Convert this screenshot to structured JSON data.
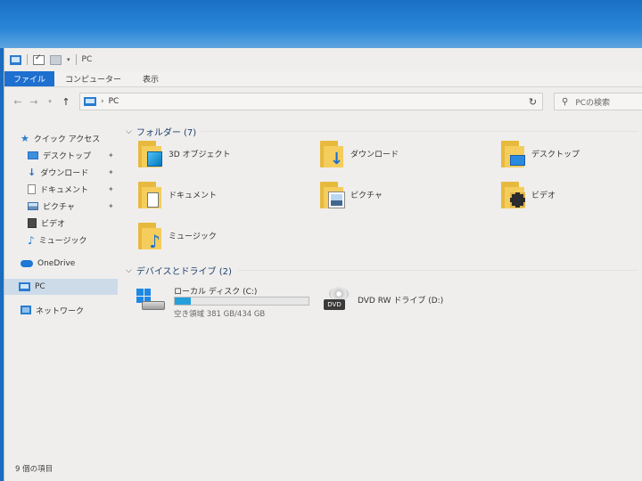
{
  "window": {
    "title": "PC"
  },
  "ribbon": {
    "tabs": [
      "ファイル",
      "コンピューター",
      "表示"
    ]
  },
  "address": {
    "location": "PC"
  },
  "search": {
    "placeholder": "PCの検索"
  },
  "nav": {
    "quick_access": "クイック アクセス",
    "quick_items": [
      {
        "label": "デスクトップ",
        "icon": "desktop-icon",
        "pinned": true
      },
      {
        "label": "ダウンロード",
        "icon": "download-icon",
        "pinned": true
      },
      {
        "label": "ドキュメント",
        "icon": "document-icon",
        "pinned": true
      },
      {
        "label": "ピクチャ",
        "icon": "pictures-icon",
        "pinned": true
      },
      {
        "label": "ビデオ",
        "icon": "video-icon",
        "pinned": false
      },
      {
        "label": "ミュージック",
        "icon": "music-icon",
        "pinned": false
      }
    ],
    "onedrive": "OneDrive",
    "pc": "PC",
    "network": "ネットワーク"
  },
  "folders": {
    "header": "フォルダー (7)",
    "items": [
      {
        "label": "3D オブジェクト",
        "icon": "3d-objects-icon"
      },
      {
        "label": "ダウンロード",
        "icon": "download-icon"
      },
      {
        "label": "デスクトップ",
        "icon": "desktop-icon"
      },
      {
        "label": "ドキュメント",
        "icon": "document-icon"
      },
      {
        "label": "ピクチャ",
        "icon": "pictures-icon"
      },
      {
        "label": "ビデオ",
        "icon": "video-icon"
      },
      {
        "label": "ミュージック",
        "icon": "music-icon"
      }
    ]
  },
  "drives": {
    "header": "デバイスとドライブ (2)",
    "c": {
      "label": "ローカル ディスク (C:)",
      "free_text": "空き領域 381 GB/434 GB",
      "used_fraction": 0.12,
      "bar_color": "#26a0da"
    },
    "dvd": {
      "label": "DVD RW ドライブ (D:)",
      "badge": "DVD"
    }
  },
  "status": {
    "count": "9 個の項目"
  },
  "colors": {
    "accent": "#1d6fd0",
    "selection": "#cddbe9",
    "folder": "#f4cd5c"
  }
}
